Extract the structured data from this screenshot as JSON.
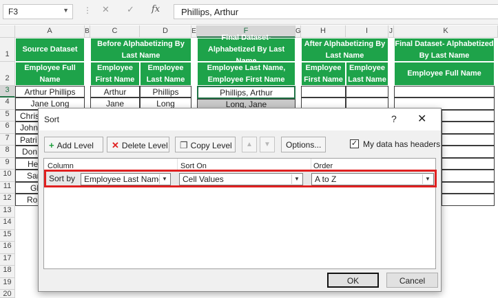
{
  "formula_bar": {
    "name_box": "F3",
    "fx": "fx",
    "formula": "Phillips, Arthur"
  },
  "columns": [
    "A",
    "B",
    "C",
    "D",
    "E",
    "F",
    "G",
    "H",
    "I",
    "J",
    "K"
  ],
  "rows": [
    "1",
    "2",
    "3",
    "4",
    "5",
    "6",
    "7",
    "8",
    "9",
    "10",
    "11",
    "12",
    "13",
    "14",
    "15",
    "16",
    "17",
    "18",
    "19",
    "20"
  ],
  "headers": {
    "source_dataset": "Source Dataset",
    "employee_full_name": "Employee Full Name",
    "before_title": "Before Alphabetizing By Last Name",
    "employee_first_name": "Employee First Name",
    "employee_last_name": "Employee Last Name",
    "final_title": "Final Dataset- Alphabetized By Last Name",
    "final_sub": "Employee Last Name, Employee First Name",
    "after_title": "After Alphabetizing By Last Name",
    "final2_title": "Final Dataset- Alphabetized By Last Name",
    "final2_sub": "Employee Full Name"
  },
  "cells": {
    "A3": "Arthur Phillips",
    "A4": "Jane Long",
    "A5": "Chris",
    "A6": "Johnn",
    "A7": "Patri",
    "A8": "Don",
    "A9": "He",
    "A10": "Sar",
    "A11": "Gl",
    "A12": "Ros",
    "C3": "Arthur",
    "C4": "Jane",
    "D3": "Phillips",
    "D4": "Long",
    "F3": "Phillips, Arthur",
    "F4": "Long, Jane"
  },
  "dialog": {
    "title": "Sort",
    "help": "?",
    "close": "✕",
    "add_level": {
      "label": "Add Level",
      "icon": "plus-icon"
    },
    "delete_level": {
      "label": "Delete Level",
      "icon": "delete-x-icon"
    },
    "copy_level": {
      "label": "Copy Level",
      "icon": "copy-icon"
    },
    "move_up": "▲",
    "move_down": "▼",
    "options": "Options...",
    "headers_checkbox": {
      "label": "My data has headers",
      "checked": true
    },
    "col_header": "Column",
    "sorton_header": "Sort On",
    "order_header": "Order",
    "sort_by_label": "Sort by",
    "column_value": "Employee Last Name,",
    "sorton_value": "Cell Values",
    "order_value": "A to Z",
    "ok": "OK",
    "cancel": "Cancel"
  },
  "colors": {
    "header_green": "#1ea34a",
    "highlight_red": "#e02020",
    "excel_green": "#217346"
  }
}
